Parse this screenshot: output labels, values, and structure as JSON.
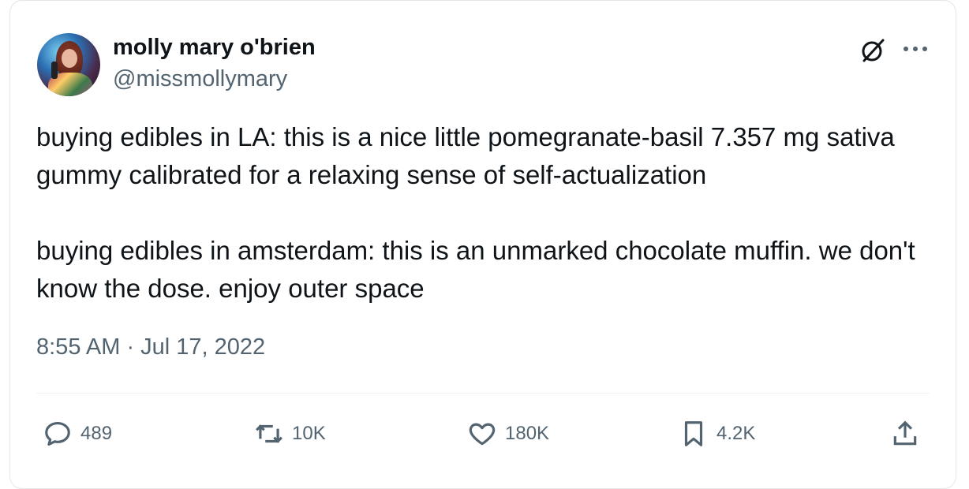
{
  "author": {
    "display_name": "molly mary o'brien",
    "handle": "@missmollymary",
    "avatar_icon": "profile-photo"
  },
  "tweet": {
    "paragraphs": [
      "buying edibles in LA: this is a nice little pomegranate-basil 7.357 mg sativa gummy calibrated for a relaxing sense of self-actualization",
      "buying edibles in amsterdam: this is an unmarked chocolate muffin. we don't know the dose. enjoy outer space"
    ],
    "timestamp": "8:55 AM · Jul 17, 2022"
  },
  "actions": {
    "replies": "489",
    "reposts": "10K",
    "likes": "180K",
    "bookmarks": "4.2K"
  },
  "icons": {
    "header": [
      "grok-icon",
      "more-options-icon"
    ],
    "actions": [
      "reply-icon",
      "repost-icon",
      "like-icon",
      "bookmark-icon",
      "share-icon"
    ]
  },
  "colors": {
    "text_primary": "#0f1419",
    "text_secondary": "#536471",
    "border": "#e6e6e6"
  }
}
